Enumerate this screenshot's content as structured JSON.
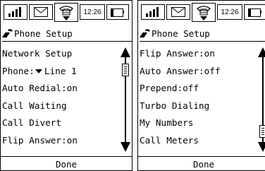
{
  "screens": [
    {
      "status_bar": {
        "time": "12:26",
        "icons": [
          "signal-icon",
          "mail-icon",
          "phone-icon",
          "battery-icon"
        ]
      },
      "header": {
        "title": "Phone Setup",
        "icon": "phone-setup-logo-icon"
      },
      "items": [
        {
          "label": "Network Setup"
        },
        {
          "label": "Phone:",
          "dropdown_value": "Line 1"
        },
        {
          "label": "Auto Redial:on"
        },
        {
          "label": "Call Waiting"
        },
        {
          "label": "Call Divert"
        },
        {
          "label": "Flip Answer:on"
        }
      ],
      "scrollbar": {
        "position": 0.1
      },
      "footer": {
        "label": "Done"
      }
    },
    {
      "status_bar": {
        "time": "12:26",
        "icons": [
          "signal-icon",
          "mail-icon",
          "phone-icon",
          "battery-icon"
        ]
      },
      "header": {
        "title": "Phone Setup",
        "icon": "phone-setup-logo-icon"
      },
      "items": [
        {
          "label": "Flip Answer:on"
        },
        {
          "label": "Auto Answer:off"
        },
        {
          "label": "Prepend:off"
        },
        {
          "label": "Turbo Dialing"
        },
        {
          "label": "My Numbers"
        },
        {
          "label": "Call Meters"
        }
      ],
      "scrollbar": {
        "position": 0.92
      },
      "footer": {
        "label": "Done"
      }
    }
  ]
}
